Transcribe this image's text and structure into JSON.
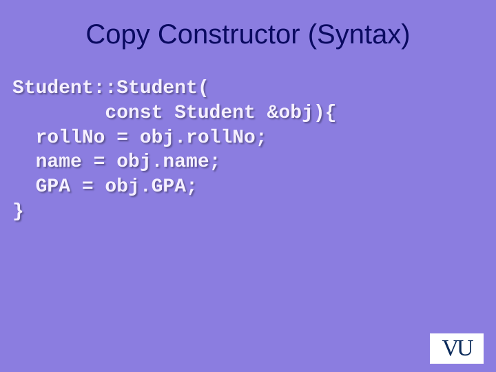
{
  "slide": {
    "title": "Copy Constructor (Syntax)",
    "code_lines": {
      "l0": "Student::Student(",
      "l1": "        const Student &obj){",
      "l2": "  rollNo = obj.rollNo;",
      "l3": "  name = obj.name;",
      "l4": "  GPA = obj.GPA;",
      "l5": "}"
    }
  },
  "logo": {
    "text": "VU"
  }
}
